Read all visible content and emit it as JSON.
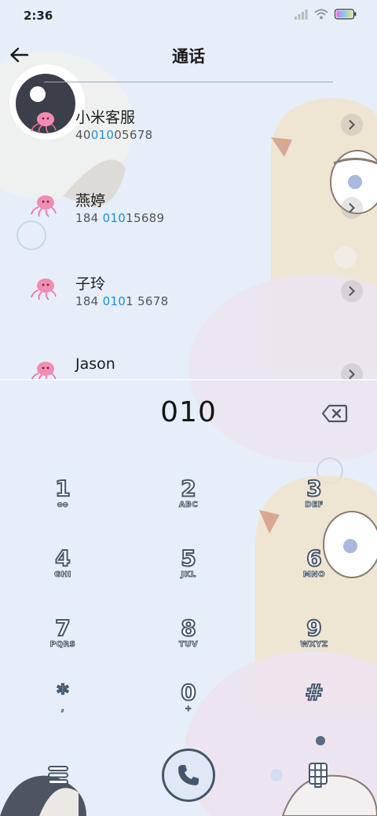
{
  "status_bar": {
    "time": "2:36"
  },
  "header": {
    "title": "通话"
  },
  "contacts": [
    {
      "name": "小米客服",
      "number_pre": "40",
      "number_match": "010",
      "number_post": "05678"
    },
    {
      "name": "燕婷",
      "number_pre": "184 ",
      "number_match": "010",
      "number_post": "15689"
    },
    {
      "name": "子玲",
      "number_pre": "184 ",
      "number_match": "010",
      "number_post": "1 5678"
    },
    {
      "name": "Jason",
      "number_pre": "",
      "number_match": "",
      "number_post": ""
    }
  ],
  "dialer": {
    "input": "010"
  },
  "keypad": [
    {
      "digit": "1",
      "letters": "ᴑᴑ"
    },
    {
      "digit": "2",
      "letters": "ABC"
    },
    {
      "digit": "3",
      "letters": "DEF"
    },
    {
      "digit": "4",
      "letters": "GHI"
    },
    {
      "digit": "5",
      "letters": "JKL"
    },
    {
      "digit": "6",
      "letters": "MNO"
    },
    {
      "digit": "7",
      "letters": "PQRS"
    },
    {
      "digit": "8",
      "letters": "TUV"
    },
    {
      "digit": "9",
      "letters": "WXYZ"
    },
    {
      "digit": "*",
      "letters": ","
    },
    {
      "digit": "0",
      "letters": "+"
    },
    {
      "digit": "#",
      "letters": ""
    }
  ],
  "icons": {
    "back": "back-arrow-icon",
    "chevron": "chevron-right-icon",
    "backspace": "backspace-icon",
    "menu": "menu-icon",
    "call": "phone-icon",
    "dialpad": "dialpad-icon"
  },
  "colors": {
    "background": "#e6eef9",
    "number_highlight": "#1a8fd6",
    "key_outline": "#46566a",
    "avatar": "#f06b9c"
  }
}
